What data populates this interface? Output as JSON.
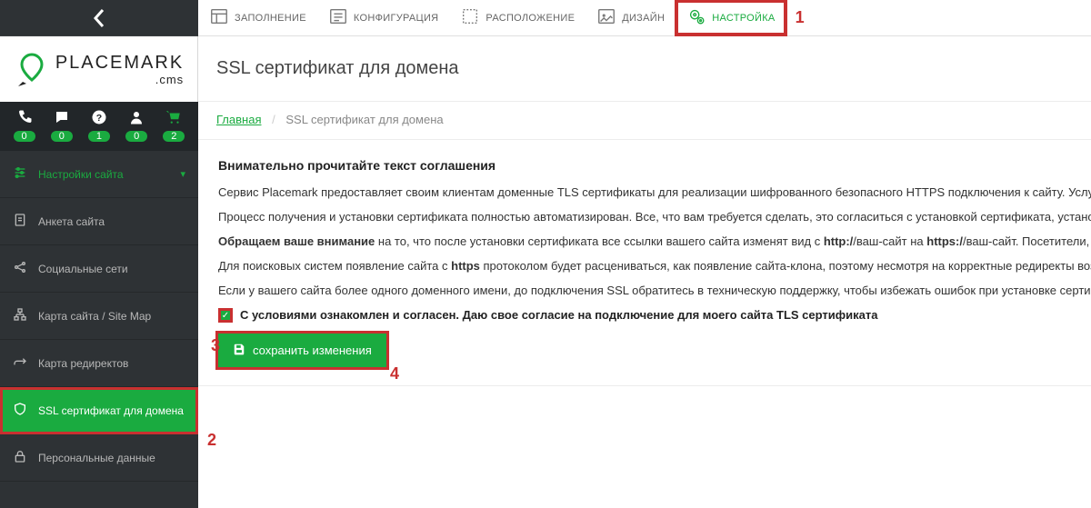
{
  "logo": {
    "main": "PLACEMARK",
    "sub": ".cms"
  },
  "quick": [
    {
      "icon": "phone",
      "badge": "0"
    },
    {
      "icon": "chat",
      "badge": "0"
    },
    {
      "icon": "help",
      "badge": "1"
    },
    {
      "icon": "user",
      "badge": "0"
    },
    {
      "icon": "cart",
      "badge": "2"
    }
  ],
  "topnav": [
    {
      "label": "ЗАПОЛНЕНИЕ"
    },
    {
      "label": "КОНФИГУРАЦИЯ"
    },
    {
      "label": "РАСПОЛОЖЕНИЕ"
    },
    {
      "label": "ДИЗАЙН"
    },
    {
      "label": "НАСТРОЙКА",
      "active": true,
      "highlight": true
    }
  ],
  "callouts": {
    "c1": "1",
    "c2": "2",
    "c3": "3",
    "c4": "4"
  },
  "page_title": "SSL сертификат для домена",
  "breadcrumb": {
    "home": "Главная",
    "current": "SSL сертификат для домена"
  },
  "nav": [
    {
      "label": "Настройки сайта",
      "green": true,
      "chevron": true
    },
    {
      "label": "Анкета сайта"
    },
    {
      "label": "Социальные сети"
    },
    {
      "label": "Карта сайта / Site Map"
    },
    {
      "label": "Карта редиректов"
    },
    {
      "label": "SSL сертификат для домена",
      "active": true,
      "highlight": true
    },
    {
      "label": "Персональные данные"
    }
  ],
  "nav_icons": [
    "sliders",
    "form",
    "share",
    "sitemap",
    "redirect",
    "shield",
    "lock"
  ],
  "panel": {
    "heading": "Внимательно прочитайте текст соглашения",
    "p1": "Сервис Placemark предоставляет своим клиентам доменные TLS сертификаты для реализации шифрованного безопасного HTTPS подключения к сайту. Услуга предоставляется бесплатно на весь срок эксплуатации.",
    "p2": "Процесс получения и установки сертификата полностью автоматизирован. Все, что вам требуется сделать, это согласиться с установкой сертификата, установив галочку.",
    "p3_pre": "Обращаем ваше внимание",
    "p3_rest": " на то, что после установки сертификата все ссылки вашего сайта изменят вид с ",
    "p3_http": "http:/",
    "p3_mid": "/ваш-сайт на ",
    "p3_https": "https:/",
    "p3_end": "/ваш-сайт. Посетители, которые заходили...",
    "p4_a": "Для поисковых систем появление сайта с ",
    "p4_b": "https",
    "p4_c": " протоколом будет расцениваться, как появление сайта-клона, поэтому несмотря на корректные редиректы возможна потеря позиций. Подключение сертификатов происходит с согласия пользователя.",
    "p5": "Если у вашего сайта более одного доменного имени, до подключения SSL обратитесь в техническую поддержку, чтобы избежать ошибок при установке сертификата.",
    "agree": "С условиями ознакомлен и согласен. Даю свое согласие на подключение для моего сайта TLS сертификата",
    "save": "сохранить изменения"
  }
}
